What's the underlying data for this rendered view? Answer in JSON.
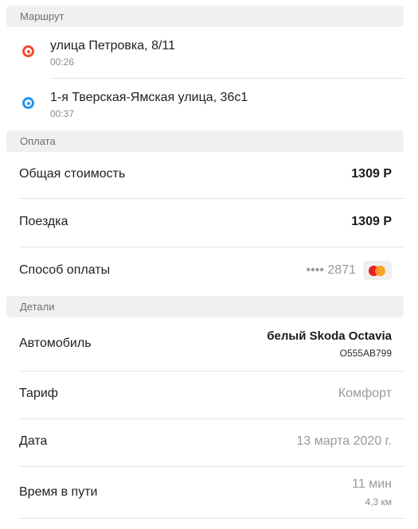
{
  "sections": {
    "route_title": "Маршрут",
    "payment_title": "Оплата",
    "details_title": "Детали"
  },
  "route": [
    {
      "address": "улица Петровка, 8/11",
      "time": "00:26",
      "marker_color": "#f04c35"
    },
    {
      "address": "1-я Тверская-Ямская улица, 36с1",
      "time": "00:37",
      "marker_color": "#2196f3"
    }
  ],
  "payment": {
    "total_label": "Общая стоимость",
    "total_value": "1309 Р",
    "ride_label": "Поездка",
    "ride_value": "1309 Р",
    "method_label": "Способ оплаты",
    "card_mask": "•••• 2871",
    "card_icon": "mastercard-icon"
  },
  "details": {
    "car_label": "Автомобиль",
    "car_value": "белый Skoda Octavia",
    "car_plate": "О555АВ799",
    "tariff_label": "Тариф",
    "tariff_value": "Комфорт",
    "date_label": "Дата",
    "date_value": "13 марта 2020 г.",
    "duration_label": "Время в пути",
    "duration_value": "11 мин",
    "distance_value": "4,3 км"
  }
}
